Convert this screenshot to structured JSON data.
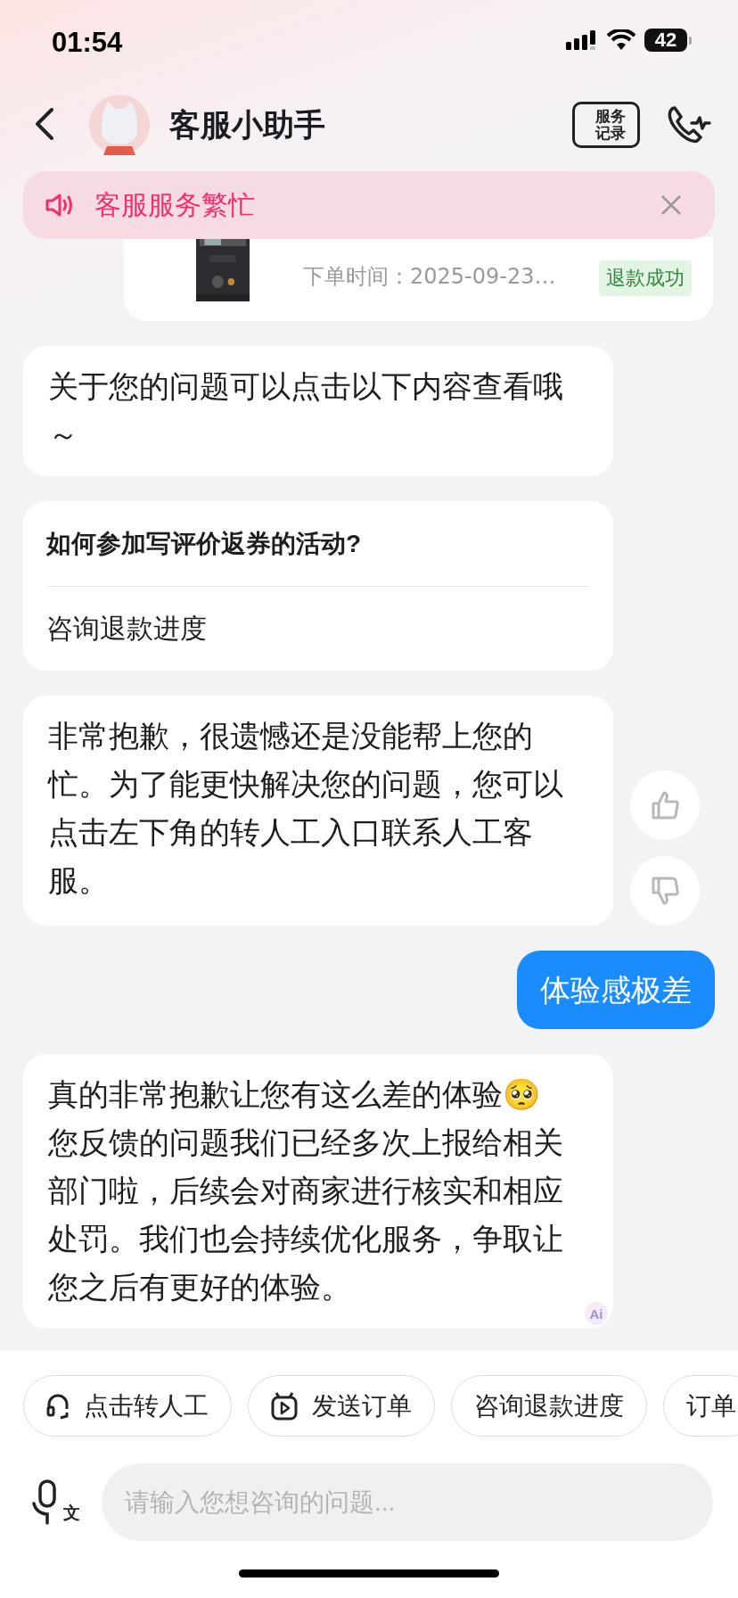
{
  "status_bar": {
    "time": "01:54",
    "battery": "42"
  },
  "header": {
    "title": "客服小助手",
    "record_button": [
      "服务",
      "记录"
    ]
  },
  "notice": {
    "text": "客服服务繁忙"
  },
  "order_card": {
    "order_time": "下单时间：2025-09-23…",
    "status": "退款成功"
  },
  "messages": [
    {
      "kind": "bot",
      "text": "关于您的问题可以点击以下内容查看哦～"
    },
    {
      "kind": "links",
      "items": [
        "如何参加写评价返券的活动?",
        "咨询退款进度"
      ]
    },
    {
      "kind": "bot",
      "text": "非常抱歉，很遗憾还是没能帮上您的忙。为了能更快解决您的问题，您可以点击左下角的转人工入口联系人工客服。",
      "feedback": true
    },
    {
      "kind": "user",
      "text": "体验感极差"
    },
    {
      "kind": "bot",
      "text": "真的非常抱歉让您有这么差的体验🥺 您反馈的问题我们已经多次上报给相关部门啦，后续会对商家进行核实和相应处罚。我们也会持续优化服务，争取让您之后有更好的体验。",
      "ai_badge": "Ai"
    }
  ],
  "quick_actions": [
    {
      "kind": "transfer",
      "label": "点击转人工"
    },
    {
      "kind": "send_order",
      "label": "发送订单"
    },
    {
      "kind": "plain",
      "label": "咨询退款进度"
    },
    {
      "kind": "plain",
      "label": "订单"
    }
  ],
  "input": {
    "voice_label": "文",
    "placeholder": "请输入您想咨询的问题..."
  }
}
